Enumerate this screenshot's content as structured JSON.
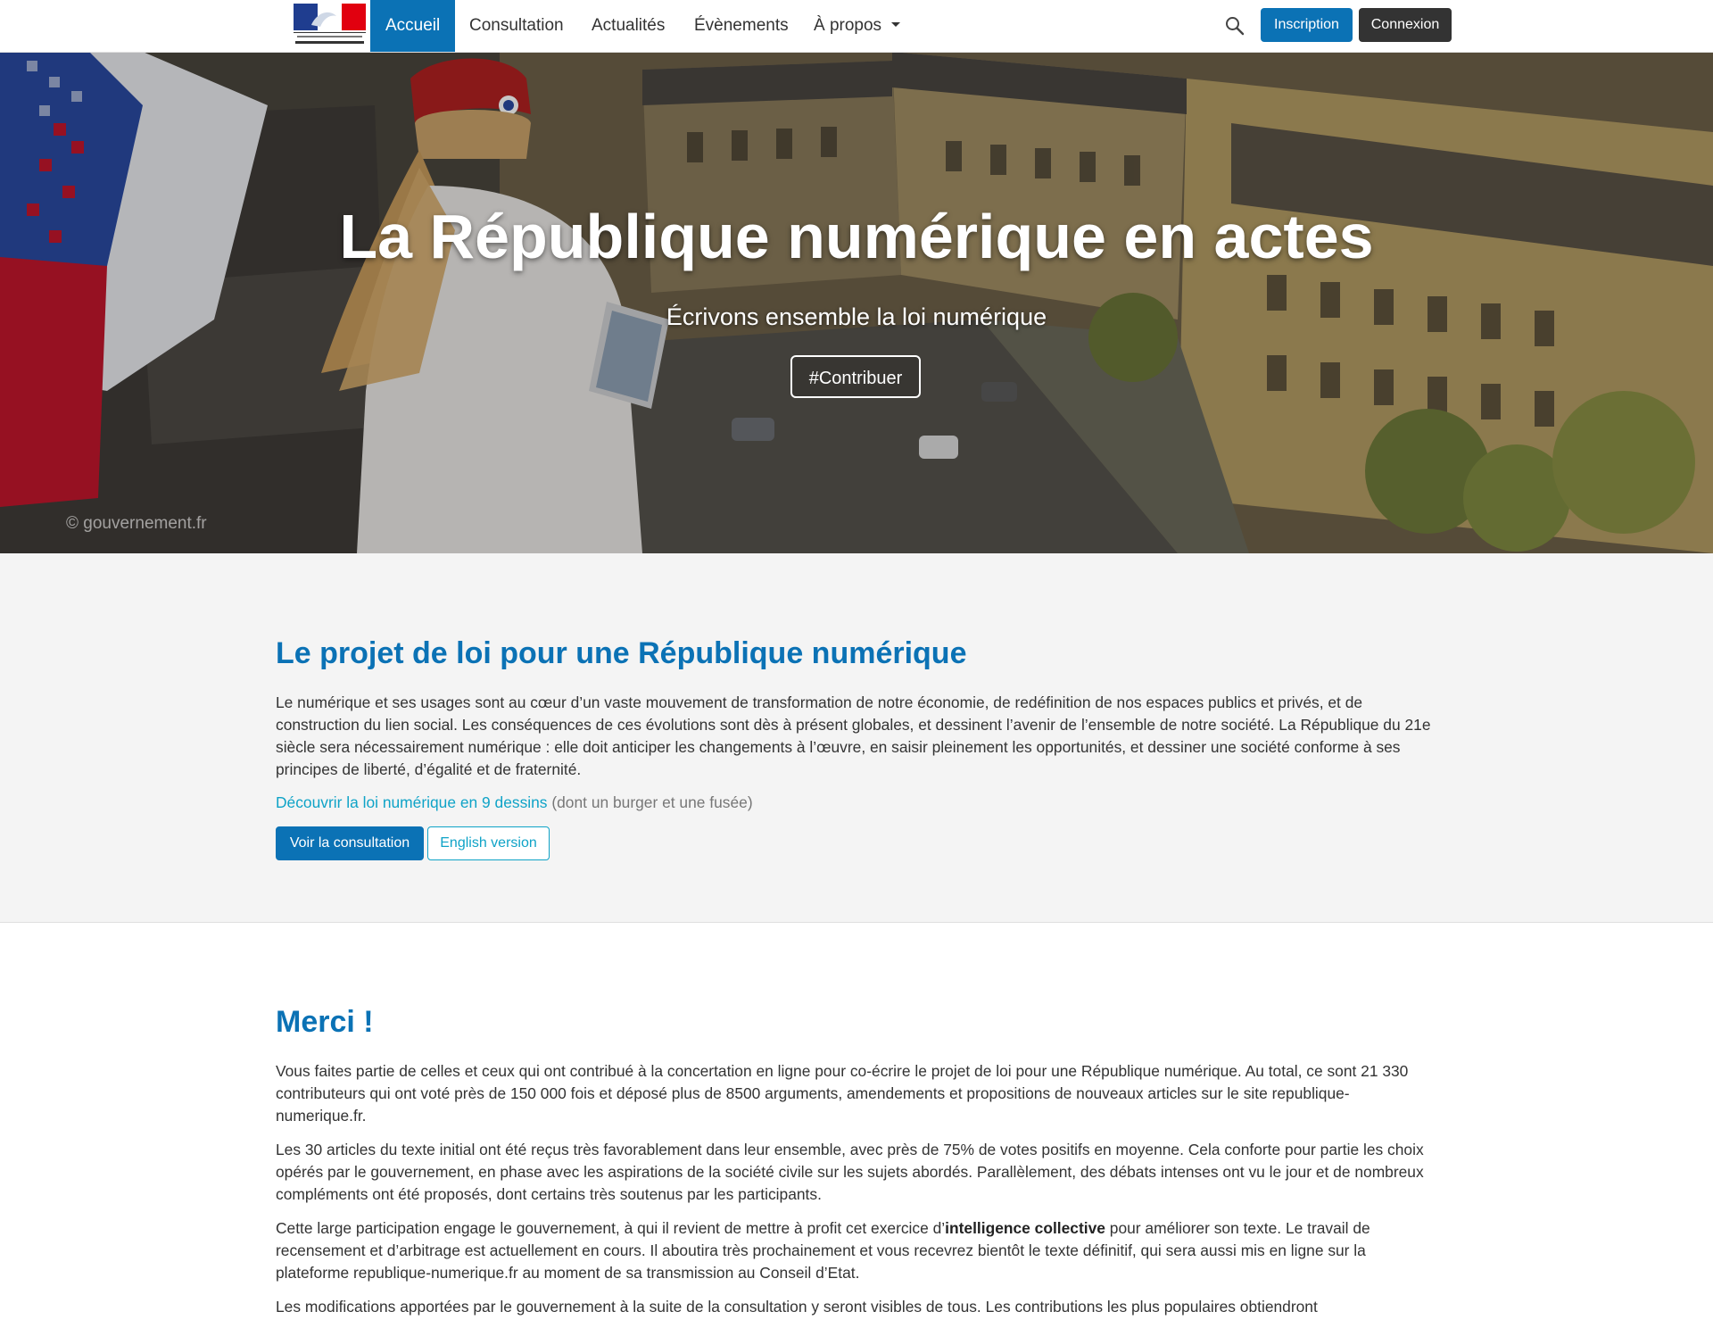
{
  "nav": {
    "logo_alt": "République Française",
    "items": [
      {
        "label": "Accueil",
        "active": true
      },
      {
        "label": "Consultation",
        "active": false
      },
      {
        "label": "Actualités",
        "active": false
      },
      {
        "label": "Évènements",
        "active": false
      },
      {
        "label": "À propos",
        "active": false,
        "dropdown": true
      }
    ],
    "search_icon": "search-icon",
    "inscription_label": "Inscription",
    "connexion_label": "Connexion"
  },
  "hero": {
    "title": "La République numérique en actes",
    "subtitle": "Écrivons ensemble la loi numérique",
    "cta_label": "#Contribuer",
    "credit": "© gouvernement.fr"
  },
  "intro": {
    "title": "Le projet de loi pour une République numérique",
    "paragraph": "Le numérique et ses usages sont au cœur d’un vaste mouvement de transformation de notre économie, de redéfinition de nos espaces publics et privés, et de construction du lien social. Les conséquences de ces évolutions sont dès à présent globales, et dessinent l’avenir de l’ensemble de notre société. La République du 21e siècle sera nécessairement numérique : elle doit anticiper les changements à l’œuvre, en saisir pleinement les opportunités, et dessiner une société conforme à ses principes de liberté, d’égalité et de fraternité.",
    "link_text": "Découvrir la loi numérique en 9 dessins",
    "link_note": "(dont un burger et une fusée)",
    "primary_button": "Voir la consultation",
    "secondary_button": "English version"
  },
  "thanks": {
    "title": "Merci !",
    "p1": "Vous faites partie de celles et ceux qui ont contribué à la concertation en ligne pour co-écrire le projet de loi pour une République numérique. Au total, ce sont 21 330 contributeurs qui ont voté près de 150 000 fois et déposé plus de 8500 arguments, amendements et propositions de nouveaux articles sur le site republique-numerique.fr.",
    "p2": "Les 30 articles du texte initial ont été reçus très favorablement dans leur ensemble, avec près de 75% de votes positifs en moyenne. Cela conforte pour partie les choix opérés par le gouvernement, en phase avec les aspirations de la société civile sur les sujets abordés. Parallèlement, des débats intenses ont vu le jour et de nombreux compléments ont été proposés, dont certains très soutenus par les participants.",
    "p3_before": "Cette large participation engage le gouvernement, à qui il revient de mettre à profit cet exercice d’",
    "p3_bold": "intelligence collective",
    "p3_after": " pour améliorer son texte. Le travail de recensement et d’arbitrage est actuellement en cours. Il aboutira très prochainement et vous recevrez bientôt le texte définitif, qui sera aussi mis en ligne sur la plateforme republique-numerique.fr au moment de sa transmission au Conseil d’Etat.",
    "p4": "Les modifications apportées par le gouvernement à la suite de la consultation y seront visibles de tous. Les contributions les plus populaires obtiendront"
  },
  "colors": {
    "brand_blue": "#0b72b5",
    "link_cyan": "#0fa3c7",
    "dark_button": "#333333",
    "section_grey": "#f4f4f4"
  }
}
